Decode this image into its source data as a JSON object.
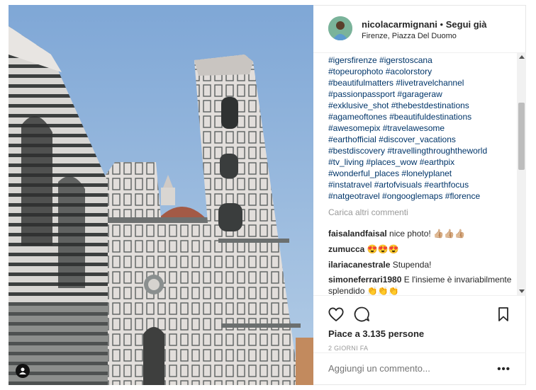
{
  "post": {
    "username": "nicolacarmignani",
    "separator": "•",
    "follow_label": "Segui già",
    "location": "Firenze, Piazza Del Duomo"
  },
  "caption_hashtags": [
    "#igersfirenze #igerstoscana",
    "#topeurophoto #acolorstory",
    "#beautifulmatters #livetravelchannel",
    "#passionpassport #garageraw",
    "#exklusive_shot #thebestdestinations",
    "#agameoftones #beautifuldestinations",
    "#awesomepix #travelawesome",
    "#earthofficial #discover_vacations",
    "#bestdiscovery #travellingthroughtheworld",
    "#tv_living #places_wow #earthpix",
    "#wonderful_places #lonelyplanet",
    "#instatravel #artofvisuals #earthfocus",
    "#natgeotravel #ongooglemaps #florence"
  ],
  "load_more_label": "Carica altri commenti",
  "comments": [
    {
      "user": "faisalandfaisal",
      "text": " nice photo! 👍🏼👍🏼👍🏼"
    },
    {
      "user": "zumucca",
      "text": " 😍😍😍"
    },
    {
      "user": "ilariacanestrale",
      "text": " Stupenda!"
    },
    {
      "user": "simoneferrari1980",
      "text": " E l'insieme è invariabilmente splendido 👏👏👏"
    }
  ],
  "likes_label": "Piace a 3.135 persone",
  "time_ago": "2 GIORNI FA",
  "add_comment_placeholder": "Aggiungi un commento...",
  "more_label": "•••",
  "icons": {
    "like": "heart-icon",
    "comment": "comment-bubble-icon",
    "save": "bookmark-icon",
    "tagged": "user-tag-icon"
  },
  "colors": {
    "sky": "#8ab1da",
    "hashtag": "#003569",
    "muted": "#999999",
    "text": "#262626"
  }
}
